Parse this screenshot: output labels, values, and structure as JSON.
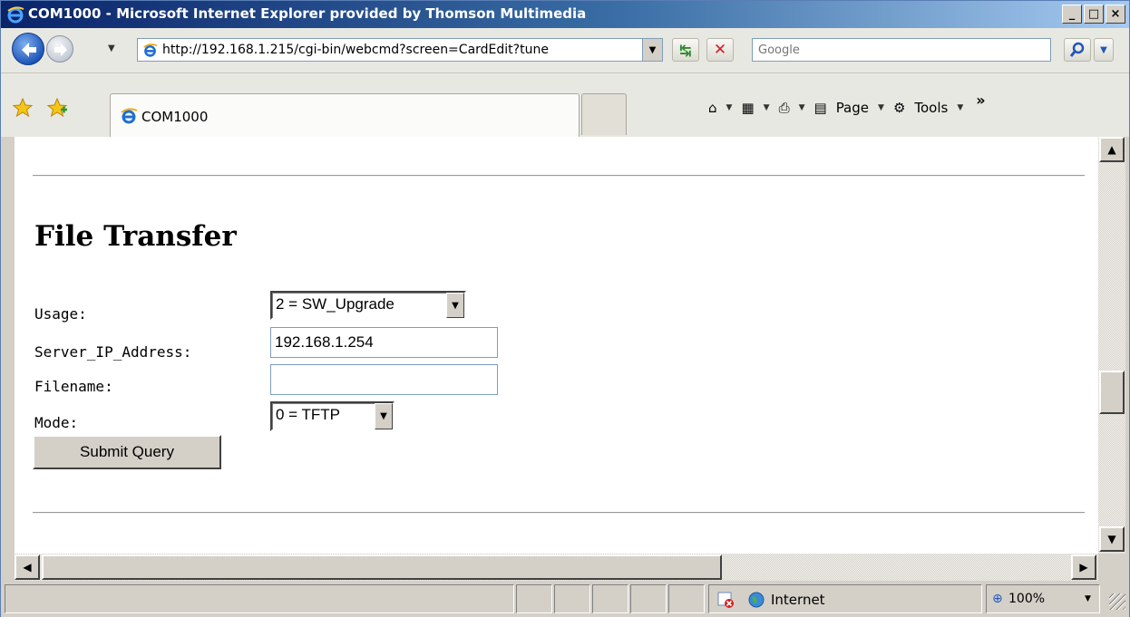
{
  "window": {
    "title": "COM1000 - Microsoft Internet Explorer provided by Thomson Multimedia",
    "minimize_glyph": "_",
    "maximize_glyph": "□",
    "close_glyph": "×"
  },
  "toolbar": {
    "address_url": "http://192.168.1.215/cgi-bin/webcmd?screen=CardEdit?tune",
    "search_placeholder": "Google",
    "refresh_icon": "refresh-icon",
    "stop_icon": "stop-icon"
  },
  "tabs": [
    {
      "label": "COM1000",
      "active": true
    }
  ],
  "command_bar": {
    "home": "home-icon",
    "feeds": "feeds-icon",
    "print": "print-icon",
    "page_label": "Page",
    "tools_label": "Tools",
    "more_glyph": "»"
  },
  "page": {
    "heading": "File Transfer",
    "form": {
      "usage_label": "Usage:",
      "usage_value": "2 = SW_Upgrade",
      "server_ip_label": "Server_IP_Address:",
      "server_ip_value": "192.168.1.254",
      "filename_label": "Filename:",
      "filename_value": "",
      "mode_label": "Mode:",
      "mode_value": "0 = TFTP",
      "submit_label": "Submit Query"
    }
  },
  "statusbar": {
    "zone_label": "Internet",
    "zoom_label": "100%"
  },
  "colors": {
    "titlebar_start": "#0a246a",
    "titlebar_end": "#a6caf0",
    "chrome": "#d4d0c8",
    "page_bg": "#ffffff"
  }
}
